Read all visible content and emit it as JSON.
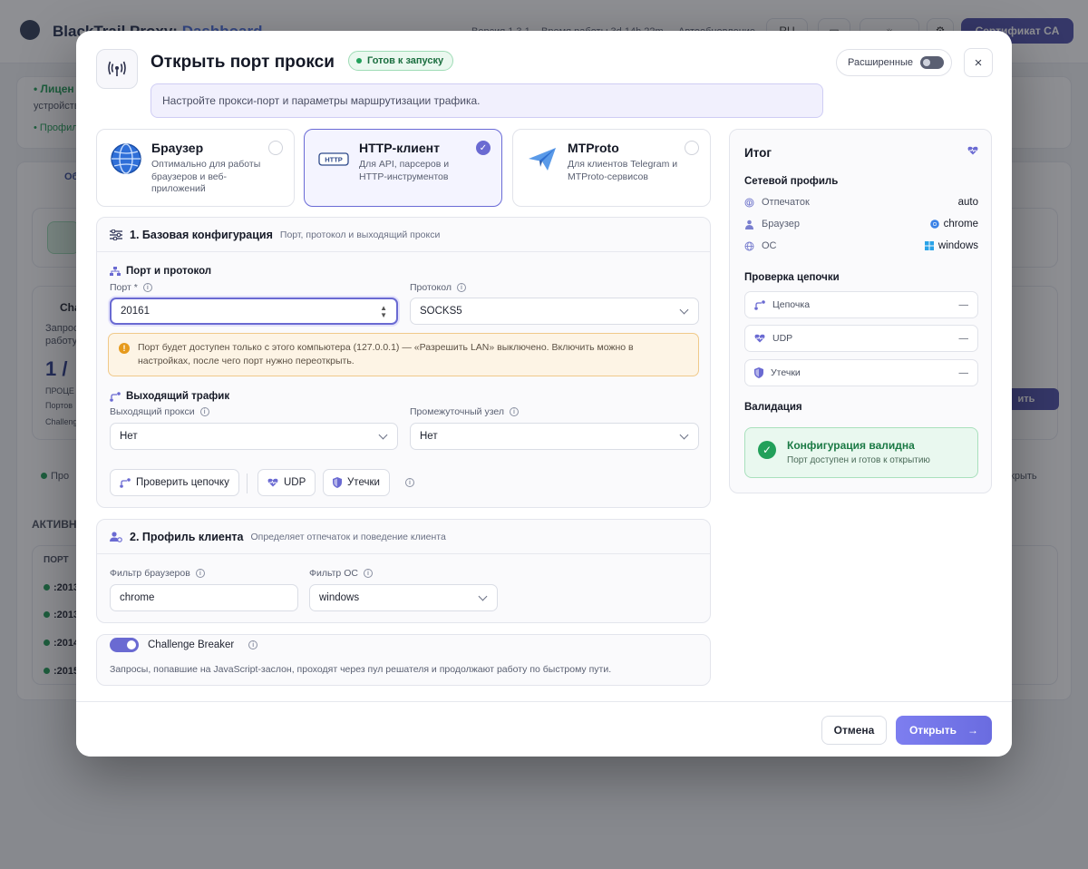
{
  "background": {
    "brand_main": "BlackTrail Proxy:",
    "brand_sub": "Dashboard",
    "version": "Версия 1.3.1",
    "uptime": "Время работы 3d 14h 22m",
    "autoupdate": "Автообновление 5 с",
    "lang": "RU",
    "ca_button": "Сертификат CA",
    "license": "• Лицен",
    "device": "устройстве",
    "profile": "• Профил",
    "tab": "Об",
    "card_title": "Cha",
    "card_line1": "Запрос",
    "card_line2": "работу",
    "counter": "1 /",
    "proc": "ПРОЦЕ",
    "ports": "Портов",
    "challenge": "Challeng",
    "right_btn": "ить",
    "row_label": "Про",
    "right_text": "ткрыть",
    "active": "АКТИВН",
    "col_port": "ПОРТ",
    "rows": [
      ":2013",
      ":2013",
      ":2014",
      ":2015"
    ]
  },
  "modal": {
    "title": "Открыть порт прокси",
    "status_badge": "Готов к запуску",
    "hint": "Настройте прокси-порт и параметры маршрутизации трафика.",
    "advanced_label": "Расширенные",
    "advanced_enabled": false,
    "close_label": "×",
    "modes": [
      {
        "title": "Браузер",
        "desc": "Оптимально для работы браузеров и веб-приложений",
        "selected": false
      },
      {
        "title": "HTTP-клиент",
        "desc": "Для API, парсеров и HTTP-инструментов",
        "selected": true,
        "icon_text": "HTTP"
      },
      {
        "title": "MTProto",
        "desc": "Для клиентов Telegram и MTProto-сервисов",
        "selected": false
      }
    ],
    "basic": {
      "title": "1. Базовая конфигурация",
      "subtitle": "Порт, протокол и выходящий прокси",
      "port_group": "Порт и протокол",
      "port_label": "Порт *",
      "port_value": "20161",
      "protocol_label": "Протокол",
      "protocol_value": "SOCKS5",
      "warning": "Порт будет доступен только с этого компьютера (127.0.0.1) — «Разрешить LAN» выключено. Включить можно в настройках, после чего порт нужно переоткрыть.",
      "outbound_group": "Выходящий трафик",
      "outbound_label": "Выходящий прокси",
      "outbound_value": "Нет",
      "intermediate_label": "Промежуточный узел",
      "intermediate_value": "Нет",
      "check_chain": "Проверить цепочку",
      "udp": "UDP",
      "leaks": "Утечки"
    },
    "client": {
      "title": "2. Профиль клиента",
      "subtitle": "Определяет отпечаток и поведение клиента",
      "browser_filter_label": "Фильтр браузеров",
      "browser_filter_value": "chrome",
      "os_filter_label": "Фильтр ОС",
      "os_filter_value": "windows"
    },
    "challenge": {
      "label": "Challenge Breaker",
      "enabled": true,
      "desc": "Запросы, попавшие на JavaScript-заслон, проходят через пул решателя и продолжают работу по быстрому пути."
    },
    "summary": {
      "title": "Итог",
      "network_profile": "Сетевой профиль",
      "fingerprint_label": "Отпечаток",
      "fingerprint_value": "auto",
      "browser_label": "Браузер",
      "browser_value": "chrome",
      "os_label": "ОС",
      "os_value": "windows",
      "chain_check": "Проверка цепочки",
      "chain_label": "Цепочка",
      "chain_value": "—",
      "udp_label": "UDP",
      "udp_value": "—",
      "leaks_label": "Утечки",
      "leaks_value": "—",
      "validation": "Валидация",
      "valid_title": "Конфигурация валидна",
      "valid_sub": "Порт доступен и готов к открытию"
    },
    "footer": {
      "cancel": "Отмена",
      "open": "Открыть",
      "open_arrow": "→"
    }
  },
  "colors": {
    "accent": "#6a6ad2",
    "success": "#22a05a",
    "warning": "#e69a1c"
  }
}
